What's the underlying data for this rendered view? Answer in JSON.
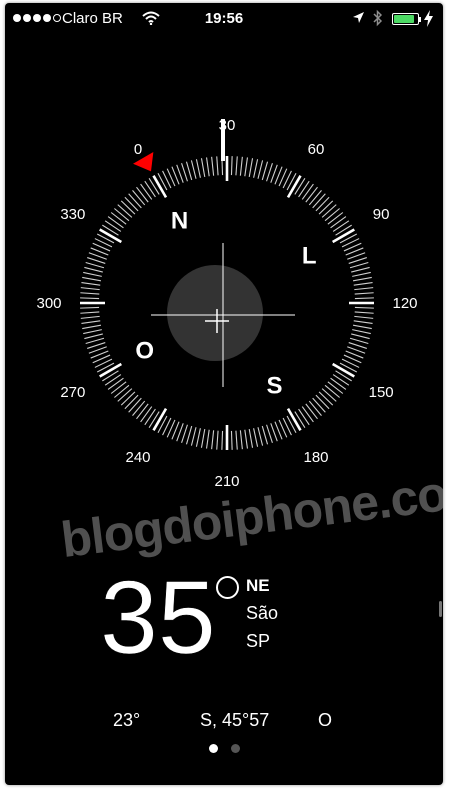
{
  "status_bar": {
    "carrier": "Claro BR",
    "time": "19:56",
    "signal_bars": 4,
    "signal_total": 5,
    "battery_level": 0.85,
    "battery_color": "#4cd964",
    "icons": [
      "wifi-icon",
      "location-arrow-icon",
      "bluetooth-icon",
      "battery-icon",
      "charging-bolt-icon"
    ]
  },
  "compass": {
    "rotation_degrees": -30,
    "bearing_marker_color": "#ff0000",
    "cardinals": [
      {
        "label": "N",
        "deg": 0
      },
      {
        "label": "L",
        "deg": 90
      },
      {
        "label": "S",
        "deg": 180
      },
      {
        "label": "O",
        "deg": 270
      }
    ],
    "degree_labels": [
      {
        "label": "0",
        "deg": 0
      },
      {
        "label": "30",
        "deg": 30
      },
      {
        "label": "60",
        "deg": 60
      },
      {
        "label": "90",
        "deg": 90
      },
      {
        "label": "120",
        "deg": 120
      },
      {
        "label": "150",
        "deg": 150
      },
      {
        "label": "180",
        "deg": 180
      },
      {
        "label": "210",
        "deg": 210
      },
      {
        "label": "240",
        "deg": 240
      },
      {
        "label": "270",
        "deg": 270
      },
      {
        "label": "300",
        "deg": 300
      },
      {
        "label": "330",
        "deg": 330
      }
    ]
  },
  "watermark": "blogdoiphone.com",
  "heading": {
    "value": "35",
    "direction": "NE",
    "city": "São",
    "state": "SP"
  },
  "bottom_info": {
    "latitude_value": "23°",
    "longitude_value": "S, 45°57",
    "longitude_direction": "O"
  },
  "pager": {
    "pages": 2,
    "current": 1
  }
}
